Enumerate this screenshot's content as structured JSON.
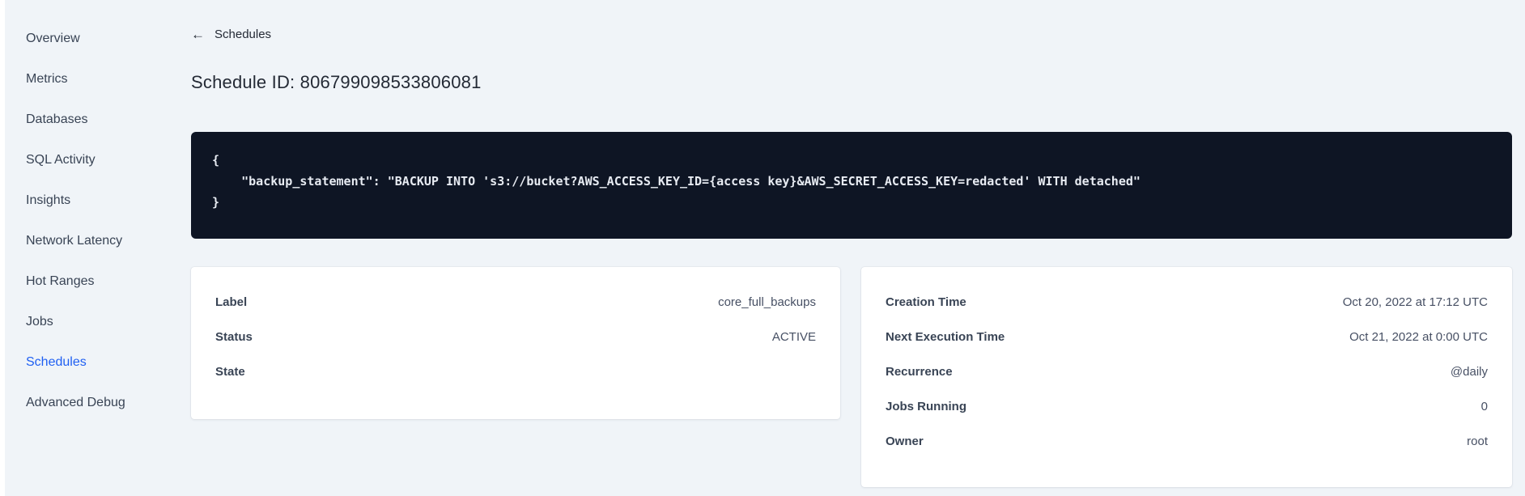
{
  "colors": {
    "accent": "#1f5ff2",
    "page_bg": "#f0f4f8",
    "code_bg": "#0e1524",
    "code_fg": "#e7ebf2",
    "text_dark": "#242a35",
    "text_slate": "#394455"
  },
  "sidebar": {
    "items": [
      {
        "label": "Overview",
        "active": false
      },
      {
        "label": "Metrics",
        "active": false
      },
      {
        "label": "Databases",
        "active": false
      },
      {
        "label": "SQL Activity",
        "active": false
      },
      {
        "label": "Insights",
        "active": false
      },
      {
        "label": "Network Latency",
        "active": false
      },
      {
        "label": "Hot Ranges",
        "active": false
      },
      {
        "label": "Jobs",
        "active": false
      },
      {
        "label": "Schedules",
        "active": true
      },
      {
        "label": "Advanced Debug",
        "active": false
      }
    ]
  },
  "header": {
    "back_icon": "←",
    "back_label": "Schedules",
    "title": "Schedule ID: 806799098533806081"
  },
  "code_block": {
    "text": "{\n    \"backup_statement\": \"BACKUP INTO 's3://bucket?AWS_ACCESS_KEY_ID={access key}&AWS_SECRET_ACCESS_KEY=redacted' WITH detached\"\n}"
  },
  "left_card": {
    "rows": [
      {
        "label": "Label",
        "value": "core_full_backups"
      },
      {
        "label": "Status",
        "value": "ACTIVE"
      },
      {
        "label": "State",
        "value": ""
      }
    ]
  },
  "right_card": {
    "rows": [
      {
        "label": "Creation Time",
        "value": "Oct 20, 2022 at 17:12 UTC"
      },
      {
        "label": "Next Execution Time",
        "value": "Oct 21, 2022 at 0:00 UTC"
      },
      {
        "label": "Recurrence",
        "value": "@daily"
      },
      {
        "label": "Jobs Running",
        "value": "0"
      },
      {
        "label": "Owner",
        "value": "root"
      }
    ]
  }
}
